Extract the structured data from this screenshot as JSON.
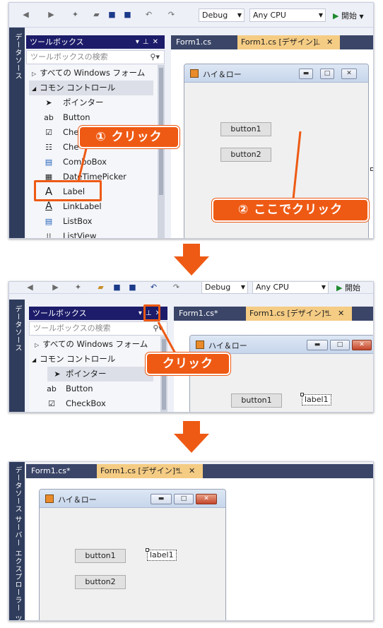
{
  "step1": {
    "toolbar": {
      "config": "Debug",
      "platform": "Any CPU",
      "run_label": "開始"
    },
    "side_strip": "データソース",
    "toolbox": {
      "title": "ツールボックス",
      "search_placeholder": "ツールボックスの検索",
      "all_forms": "すべての Windows フォーム",
      "common": "コモン コントロール",
      "items": [
        "ポインター",
        "Button",
        "CheckBox",
        "CheckedListBox",
        "ComboBox",
        "DateTimePicker",
        "Label",
        "LinkLabel",
        "ListBox",
        "ListView"
      ],
      "visible_items": [
        "ポインター",
        "Button",
        "Che",
        "Che",
        "ComboBox",
        "DateTimePicker",
        "Label",
        "LinkLabel",
        "ListBox",
        "ListView"
      ]
    },
    "tabs": {
      "code": "Form1.cs",
      "design": "Form1.cs [デザイン]"
    },
    "form": {
      "title": "ハイ＆ロー",
      "button1": "button1",
      "button2": "button2"
    },
    "callout1": "① クリック",
    "callout2": "② ここでクリック"
  },
  "step2": {
    "toolbar": {
      "config": "Debug",
      "platform": "Any CPU",
      "run_label": "開始"
    },
    "side_strip": "データソース",
    "toolbox": {
      "title": "ツールボックス",
      "search_placeholder": "ツールボックスの検索",
      "all_forms": "すべての Windows フォーム",
      "common": "コモン コントロール",
      "items": [
        "ポインター",
        "Button",
        "CheckBox"
      ]
    },
    "tabs": {
      "code": "Form1.cs*",
      "design": "Form1.cs [デザイン]*"
    },
    "form": {
      "title": "ハイ＆ロー",
      "button1": "button1",
      "label1": "label1"
    },
    "callout": "クリック"
  },
  "step3": {
    "side_strip": "データソース  サーバー エクスプローラー  ツールボ",
    "tabs": {
      "code": "Form1.cs*",
      "design": "Form1.cs [デザイン]*"
    },
    "form": {
      "title": "ハイ＆ロー",
      "button1": "button1",
      "button2": "button2",
      "label1": "label1"
    }
  },
  "colors": {
    "accent": "#ee5a14",
    "toolbox_header": "#1c1c6a",
    "active_tab": "#f5cc84",
    "tab_bar": "#3a4568"
  }
}
